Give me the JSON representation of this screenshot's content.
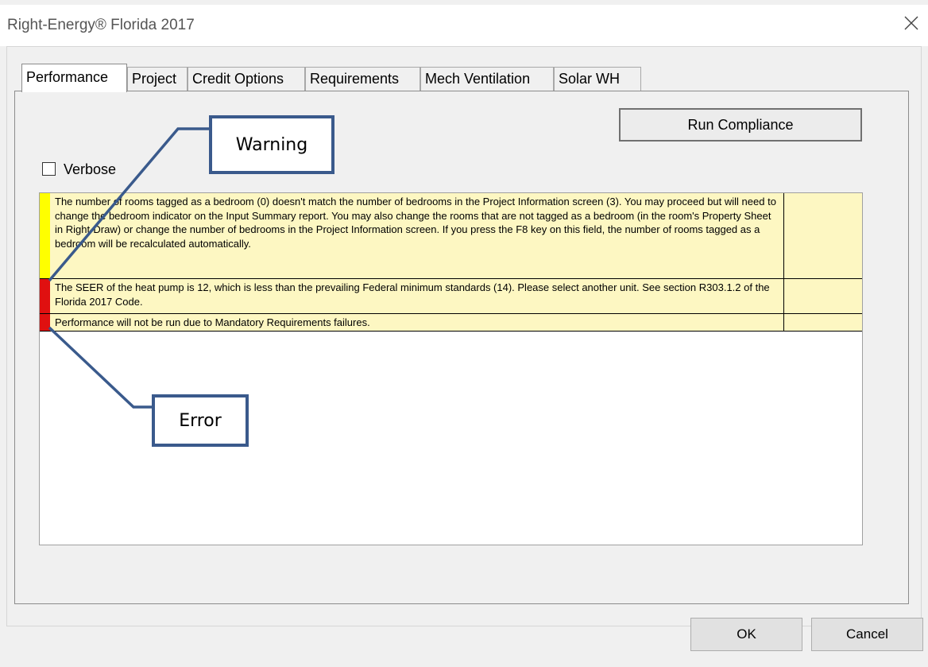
{
  "window": {
    "title": "Right-Energy® Florida 2017",
    "close_icon": "close-icon"
  },
  "tabs": [
    {
      "label": "Performance",
      "active": true
    },
    {
      "label": "Project",
      "active": false
    },
    {
      "label": "Credit Options",
      "active": false
    },
    {
      "label": "Requirements",
      "active": false
    },
    {
      "label": "Mech Ventilation",
      "active": false
    },
    {
      "label": "Solar WH",
      "active": false
    }
  ],
  "performance": {
    "run_button": "Run Compliance",
    "verbose_label": "Verbose",
    "verbose_checked": false,
    "messages": [
      {
        "severity": "warning",
        "color": "#ffff00",
        "text": "The number of rooms tagged as a bedroom (0) doesn't match the number of bedrooms in the Project Information screen (3). You may proceed but will need to change the bedroom indicator on the Input Summary report.  You may also change the rooms that are not tagged as a bedroom (in the room's Property Sheet in Right-Draw) or change the number of bedrooms in the Project Information screen.  If you press the F8 key on this field, the number of rooms tagged as a bedroom will be recalculated automatically."
      },
      {
        "severity": "error",
        "color": "#e01010",
        "text": "The SEER of the heat pump is 12, which is less than the prevailing Federal minimum standards (14).  Please select another unit. See section R303.1.2 of the Florida 2017 Code."
      },
      {
        "severity": "error",
        "color": "#e01010",
        "text": "Performance will not be run due to Mandatory Requirements failures."
      }
    ]
  },
  "callouts": {
    "warning_label": "Warning",
    "error_label": "Error",
    "line_color": "#3a5a8c"
  },
  "footer": {
    "ok_label": "OK",
    "cancel_label": "Cancel"
  }
}
